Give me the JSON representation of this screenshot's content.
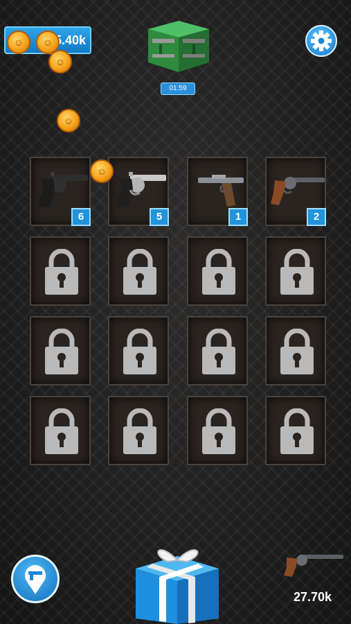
{
  "header": {
    "coin_balance": "5.40k",
    "crate_timer": "01:59"
  },
  "guns": [
    {
      "name": "revolver-black",
      "level": "6"
    },
    {
      "name": "revolver-silver",
      "level": "5"
    },
    {
      "name": "luger-pistol",
      "level": "1"
    },
    {
      "name": "colt-revolver",
      "level": "2"
    }
  ],
  "locked_slot_count": 12,
  "footer": {
    "buy_price": "27.70k"
  },
  "colors": {
    "accent_blue": "#2294dc",
    "slot_bg": "#2a2420",
    "coin_gold": "#f6a21a",
    "crate_green": "#2e8b3e"
  },
  "icons": [
    "coin-icon",
    "gear-icon",
    "crate-icon",
    "lock-icon",
    "map-pin-icon",
    "gift-icon",
    "revolver-icon"
  ]
}
